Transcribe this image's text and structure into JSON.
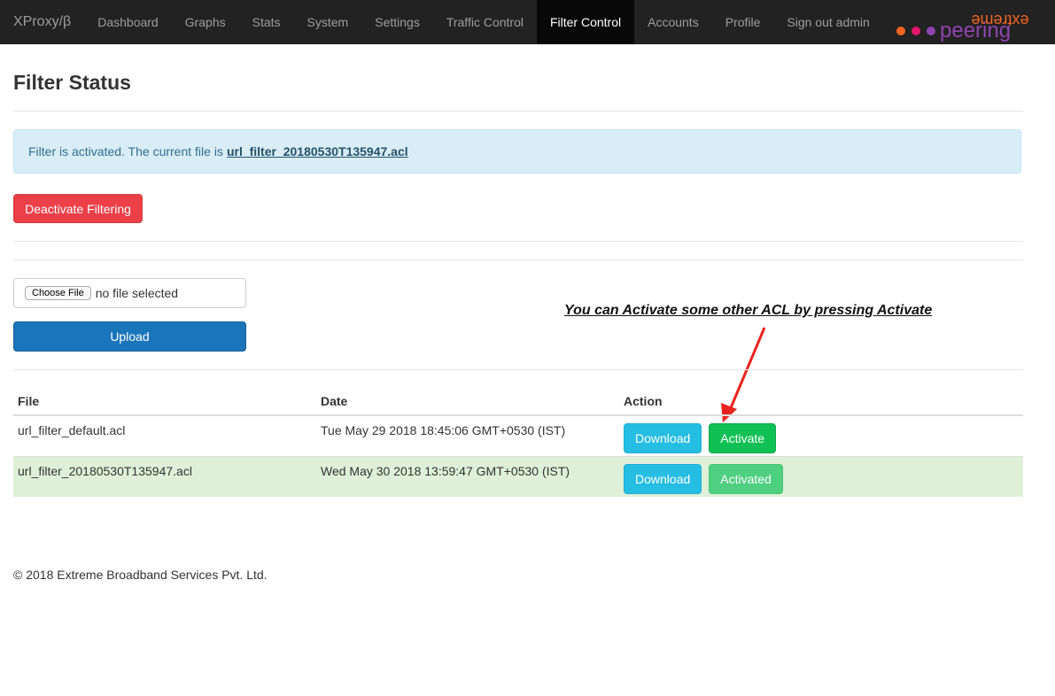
{
  "nav": {
    "brand": "XProxy/β",
    "items": [
      {
        "label": "Dashboard",
        "active": false
      },
      {
        "label": "Graphs",
        "active": false
      },
      {
        "label": "Stats",
        "active": false
      },
      {
        "label": "System",
        "active": false
      },
      {
        "label": "Settings",
        "active": false
      },
      {
        "label": "Traffic Control",
        "active": false
      },
      {
        "label": "Filter Control",
        "active": true
      },
      {
        "label": "Accounts",
        "active": false
      },
      {
        "label": "Profile",
        "active": false
      },
      {
        "label": "Sign out admin",
        "active": false
      }
    ],
    "logo_text_top": "extreme",
    "logo_text_bottom": "peering"
  },
  "page": {
    "title": "Filter Status",
    "alert_text": "Filter is activated. The current file is",
    "alert_link": "url_filter_20180530T135947.acl",
    "deactivate_label": "Deactivate Filtering",
    "choose_file_label": "Choose File",
    "no_file_text": "no file selected",
    "upload_label": "Upload",
    "annotation": "You can Activate some other ACL by pressing Activate"
  },
  "table": {
    "headers": [
      "File",
      "Date",
      "Action"
    ],
    "rows": [
      {
        "file": "url_filter_default.acl",
        "date": "Tue May 29 2018 18:45:06 GMT+0530 (IST)",
        "download": "Download",
        "activate": "Activate"
      },
      {
        "file": "url_filter_20180530T135947.acl",
        "date": "Wed May 30 2018 13:59:47 GMT+0530 (IST)",
        "download": "Download",
        "activate": "Activated"
      }
    ]
  },
  "footer": "© 2018 Extreme Broadband Services Pvt. Ltd.",
  "colors": {
    "navbar": "#222222",
    "danger": "#ec3f48",
    "primary": "#1b75bb",
    "info": "#26bde2",
    "success": "#10c054",
    "annotation_arrow": "#e8231f",
    "logo_dots": [
      "#f26522",
      "#e4156b",
      "#8e44ad"
    ]
  }
}
